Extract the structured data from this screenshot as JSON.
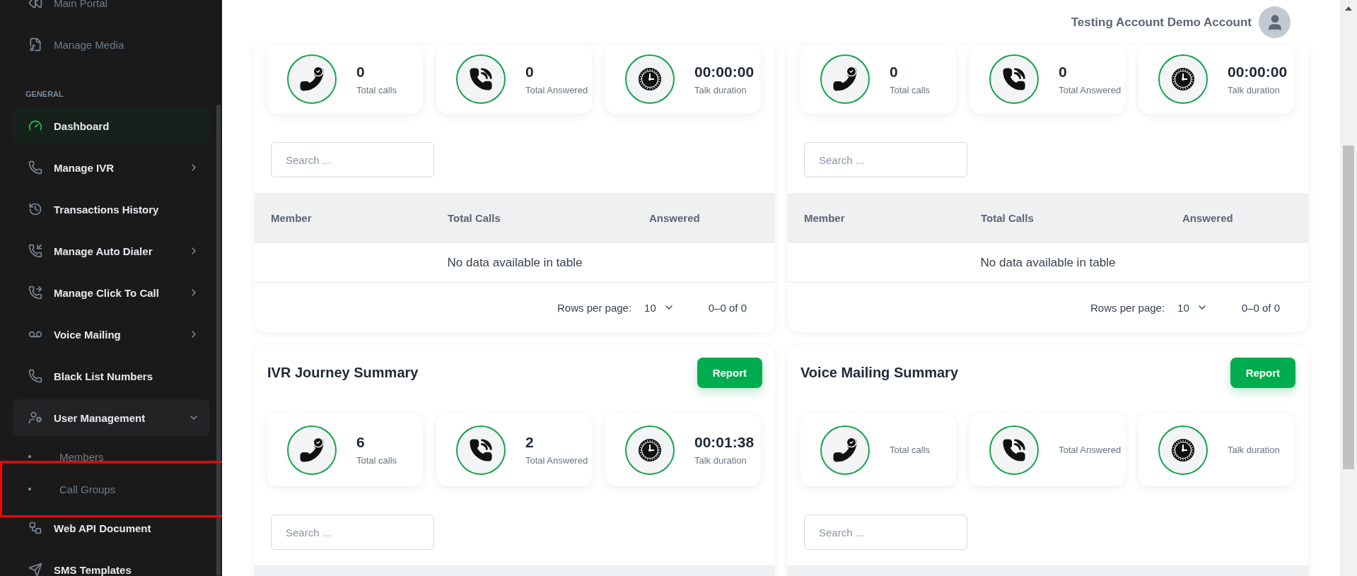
{
  "sidebar": {
    "top_items": [
      {
        "label": "Main Portal"
      },
      {
        "label": "Manage Media"
      }
    ],
    "section_title": "GENERAL",
    "items": [
      {
        "label": "Dashboard",
        "selected": true
      },
      {
        "label": "Manage IVR",
        "selected": false,
        "expanded": false
      },
      {
        "label": "Transactions History",
        "selected": false
      },
      {
        "label": "Manage Auto Dialer",
        "selected": false,
        "expanded": false
      },
      {
        "label": "Manage Click To Call",
        "selected": false,
        "expanded": false
      },
      {
        "label": "Voice Mailing",
        "selected": false,
        "expanded": false
      },
      {
        "label": "Black List Numbers",
        "selected": false
      },
      {
        "label": "User Management",
        "selected": false,
        "expanded": true,
        "children": [
          {
            "label": "Members",
            "selected": false,
            "highlighted": false
          },
          {
            "label": "Call Groups",
            "selected": false,
            "highlighted": true
          }
        ]
      },
      {
        "label": "Web API Document",
        "selected": false
      },
      {
        "label": "SMS Templates",
        "selected": false
      }
    ]
  },
  "header": {
    "account_name": "Testing Account Demo Account"
  },
  "panels": [
    {
      "stats": [
        {
          "kind": "calls",
          "value": "0",
          "label": "Total calls"
        },
        {
          "kind": "answered",
          "value": "0",
          "label": "Total Answered"
        },
        {
          "kind": "duration",
          "value": "00:00:00",
          "label": "Talk duration"
        }
      ],
      "search": {
        "placeholder": "Search ..."
      },
      "table": {
        "columns": [
          "Member",
          "Total Calls",
          "Answered"
        ],
        "empty_text": "No data available in table",
        "rows_per_page_label": "Rows per page:",
        "rows_per_page": "10",
        "range": "0–0 of 0"
      }
    },
    {
      "stats": [
        {
          "kind": "calls",
          "value": "0",
          "label": "Total calls"
        },
        {
          "kind": "answered",
          "value": "0",
          "label": "Total Answered"
        },
        {
          "kind": "duration",
          "value": "00:00:00",
          "label": "Talk duration"
        }
      ],
      "search": {
        "placeholder": "Search ..."
      },
      "table": {
        "columns": [
          "Member",
          "Total Calls",
          "Answered"
        ],
        "empty_text": "No data available in table",
        "rows_per_page_label": "Rows per page:",
        "rows_per_page": "10",
        "range": "0–0 of 0"
      }
    },
    {
      "title": "IVR Journey Summary",
      "button": "Report",
      "stats": [
        {
          "kind": "calls",
          "value": "6",
          "label": "Total calls"
        },
        {
          "kind": "answered",
          "value": "2",
          "label": "Total Answered"
        },
        {
          "kind": "duration",
          "value": "00:01:38",
          "label": "Talk duration"
        }
      ],
      "search": {
        "placeholder": "Search ..."
      }
    },
    {
      "title": "Voice Mailing Summary",
      "button": "Report",
      "stats": [
        {
          "kind": "calls",
          "label": "Total calls"
        },
        {
          "kind": "answered",
          "label": "Total Answered"
        },
        {
          "kind": "duration",
          "label": "Talk duration"
        }
      ],
      "search": {
        "placeholder": "Search ..."
      }
    }
  ]
}
